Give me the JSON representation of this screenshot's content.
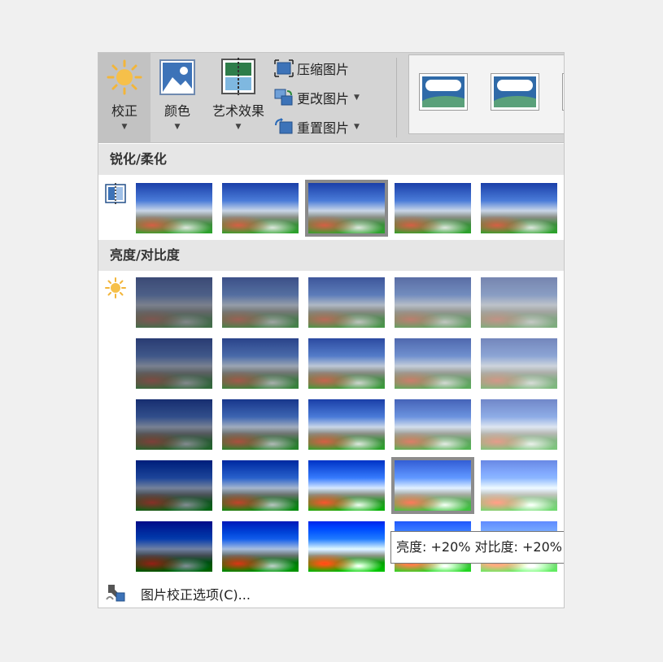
{
  "ribbon": {
    "correct_label": "校正",
    "color_label": "颜色",
    "art_label": "艺术效果",
    "compress_label": "压缩图片",
    "change_label": "更改图片",
    "reset_label": "重置图片",
    "caret": "▼"
  },
  "sections": {
    "sharpen_title": "锐化/柔化",
    "brightness_title": "亮度/对比度"
  },
  "tooltip": "亮度: +20% 对比度: +20%",
  "footer": {
    "options_label": "图片校正选项(C)..."
  },
  "icons": {
    "correct": "sun-icon",
    "color": "picture-color-icon",
    "art": "art-effects-icon",
    "compress": "compress-icon",
    "change": "change-picture-icon",
    "reset": "reset-picture-icon",
    "sharpen": "sharpen-icon",
    "brightness": "brightness-icon",
    "options": "options-icon"
  },
  "presets": {
    "sharpen": [
      {
        "level": -50,
        "selected": false
      },
      {
        "level": -25,
        "selected": false
      },
      {
        "level": 0,
        "selected": true
      },
      {
        "level": 25,
        "selected": false
      },
      {
        "level": 50,
        "selected": false
      }
    ],
    "brightness_contrast": [
      [
        {
          "b": -40,
          "c": -40
        },
        {
          "b": -20,
          "c": -40
        },
        {
          "b": 0,
          "c": -40
        },
        {
          "b": 20,
          "c": -40
        },
        {
          "b": 40,
          "c": -40
        }
      ],
      [
        {
          "b": -40,
          "c": -20
        },
        {
          "b": -20,
          "c": -20
        },
        {
          "b": 0,
          "c": -20
        },
        {
          "b": 20,
          "c": -20
        },
        {
          "b": 40,
          "c": -20
        }
      ],
      [
        {
          "b": -40,
          "c": 0
        },
        {
          "b": -20,
          "c": 0
        },
        {
          "b": 0,
          "c": 0
        },
        {
          "b": 20,
          "c": 0
        },
        {
          "b": 40,
          "c": 0
        }
      ],
      [
        {
          "b": -40,
          "c": 20
        },
        {
          "b": -20,
          "c": 20
        },
        {
          "b": 0,
          "c": 20
        },
        {
          "b": 20,
          "c": 20,
          "selected": true
        },
        {
          "b": 40,
          "c": 20
        }
      ],
      [
        {
          "b": -40,
          "c": 40
        },
        {
          "b": -20,
          "c": 40
        },
        {
          "b": 0,
          "c": 40
        },
        {
          "b": 20,
          "c": 40
        },
        {
          "b": 40,
          "c": 40
        }
      ]
    ]
  },
  "colors": {
    "ribbon_bg": "#d4d4d4",
    "section_header_bg": "#e6e6e6",
    "selected_border": "#8a8a8a",
    "sun": "#f2b53a"
  }
}
